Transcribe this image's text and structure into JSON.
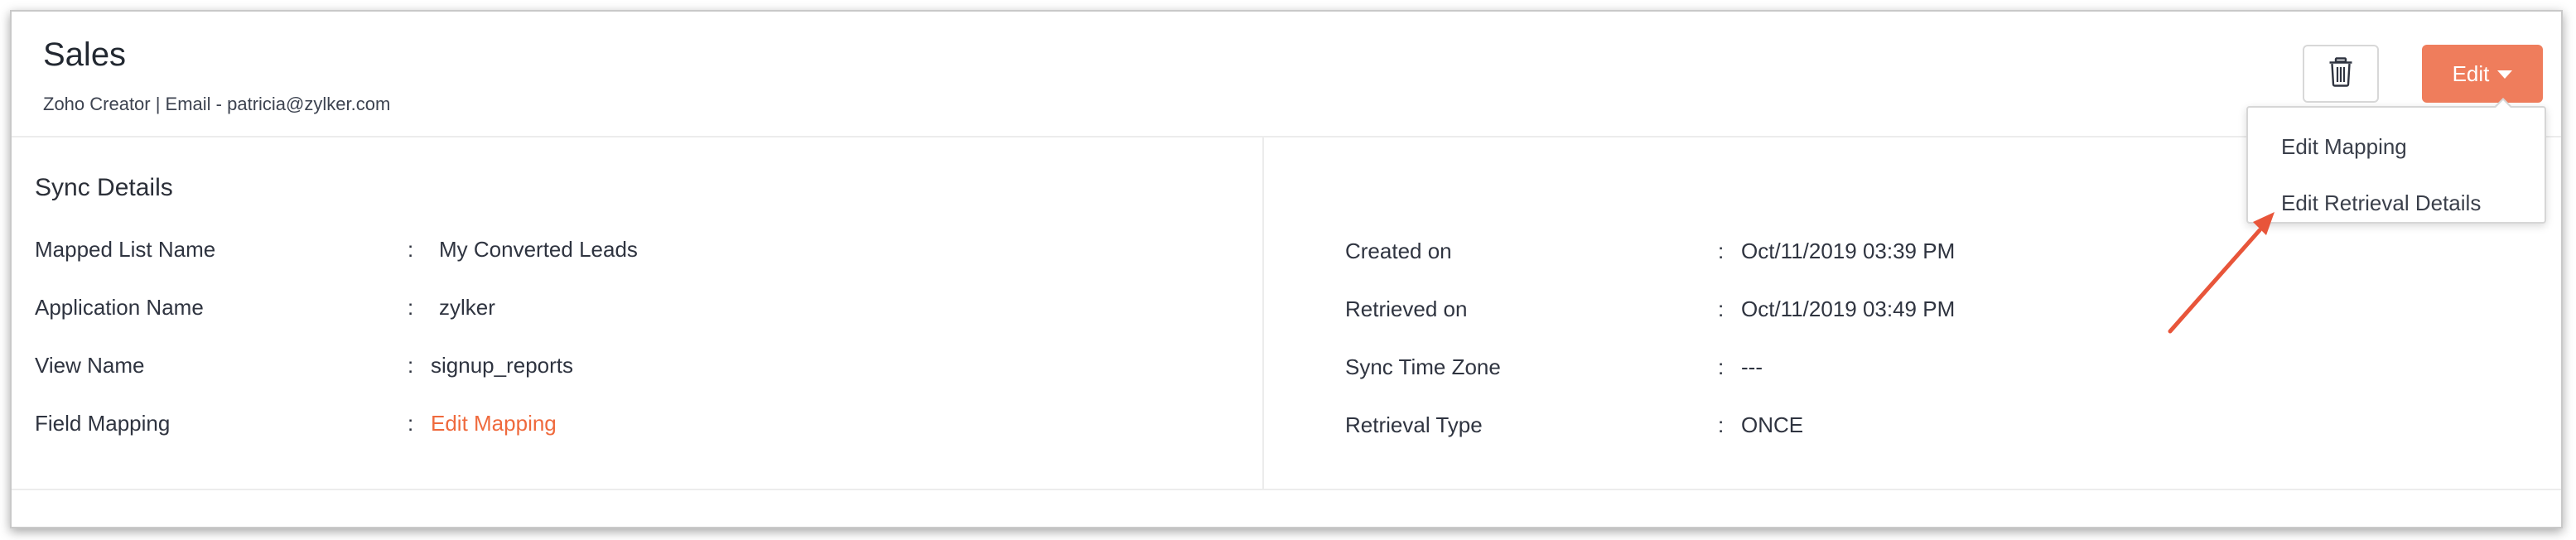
{
  "header": {
    "title": "Sales",
    "subtitle": "Zoho Creator | Email - patricia@zylker.com",
    "edit_label": "Edit"
  },
  "dropdown": {
    "items": [
      "Edit Mapping",
      "Edit Retrieval Details"
    ]
  },
  "sync_details": {
    "title": "Sync Details",
    "left_rows": [
      {
        "label": "Mapped List Name",
        "value": "My Converted Leads"
      },
      {
        "label": "Application Name",
        "value": "zylker"
      },
      {
        "label": "View Name",
        "value": "signup_reports"
      },
      {
        "label": "Field Mapping",
        "value": "Edit Mapping"
      }
    ],
    "right_rows": [
      {
        "label": "Created on",
        "value": "Oct/11/2019 03:39 PM"
      },
      {
        "label": "Retrieved on",
        "value": "Oct/11/2019 03:49 PM"
      },
      {
        "label": "Sync Time Zone",
        "value": "---"
      },
      {
        "label": "Retrieval Type",
        "value": "ONCE"
      }
    ],
    "separator": ":"
  },
  "colors": {
    "accent": "#ef7d5c",
    "link": "#ef6a3d",
    "annotation_arrow": "#e8553a"
  },
  "icons": {
    "delete": "trash-icon",
    "edit_caret": "caret-down-icon"
  }
}
